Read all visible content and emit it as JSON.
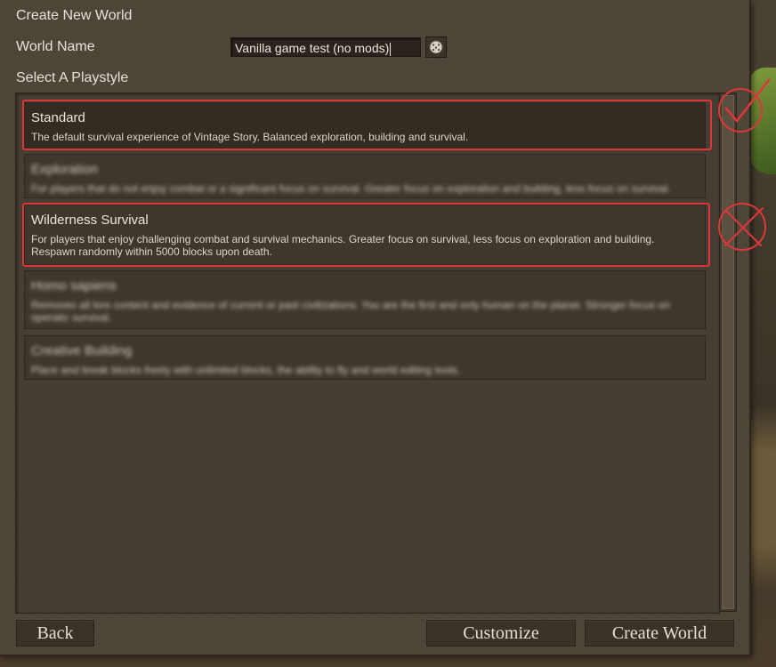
{
  "window": {
    "title": "Create New World"
  },
  "world_name": {
    "label": "World Name",
    "value": "Vanilla game test (no mods)"
  },
  "playstyle": {
    "label": "Select A Playstyle",
    "options": [
      {
        "title": "Standard",
        "description": "The default survival experience of Vintage Story. Balanced exploration, building and survival."
      },
      {
        "title": "Exploration",
        "description": "For players that do not enjoy combat or a significant focus on survival. Greater focus on exploration and building, less focus on survival."
      },
      {
        "title": "Wilderness Survival",
        "description": "For players that enjoy challenging combat and survival mechanics. Greater focus on survival, less focus on exploration and building. Respawn randomly within 5000 blocks upon death."
      },
      {
        "title": "Homo sapiens",
        "description": "Removes all lore content and evidence of current or past civilizations. You are the first and only human on the planet. Stronger focus on operatic survival."
      },
      {
        "title": "Creative Building",
        "description": "Place and break blocks freely with unlimited blocks, the ability to fly and world editing tools."
      }
    ]
  },
  "buttons": {
    "back": "Back",
    "customize": "Customize",
    "create": "Create World"
  },
  "annotations": {
    "approve": "checkmark-circle-icon",
    "reject": "x-circle-icon",
    "color": "#e0363a"
  }
}
